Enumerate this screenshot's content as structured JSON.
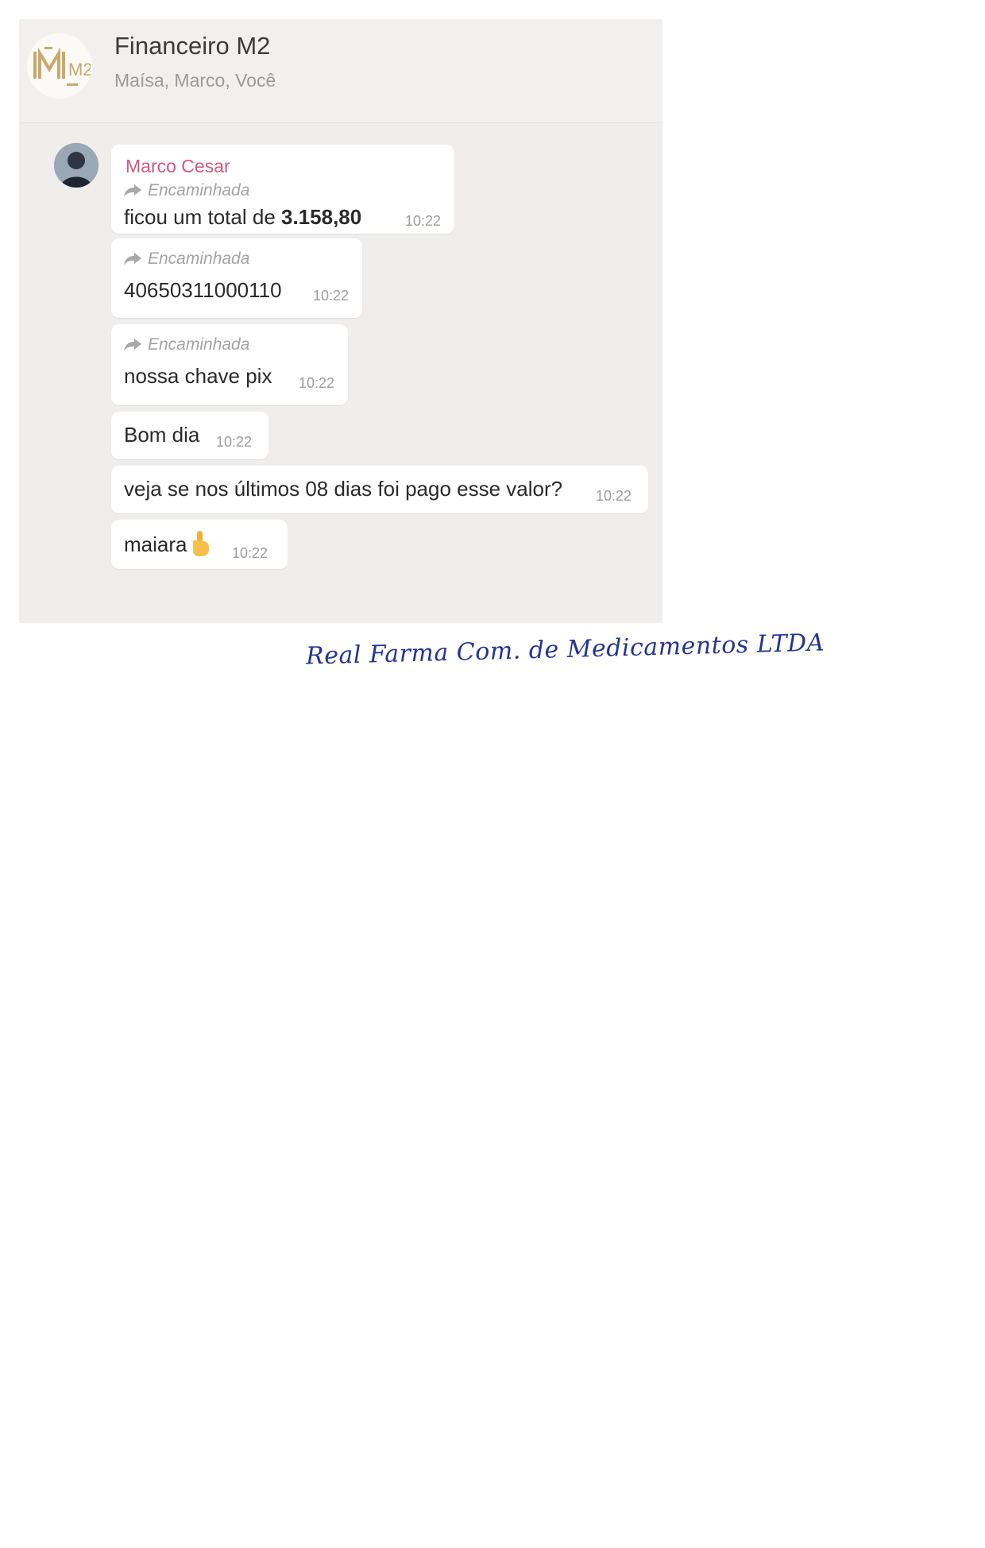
{
  "header": {
    "title": "Financeiro M2",
    "members": "Maísa, Marco, Você",
    "logo_text": "M2"
  },
  "messages": [
    {
      "sender": "Marco Cesar",
      "forwarded": "Encaminhada",
      "text_prefix": "ficou um total de ",
      "text_bold": "3.158,80",
      "time": "10:22"
    },
    {
      "forwarded": "Encaminhada",
      "text": "40650311000110",
      "time": "10:22"
    },
    {
      "forwarded": "Encaminhada",
      "text": "nossa chave pix",
      "time": "10:22"
    },
    {
      "text": "Bom dia",
      "time": "10:22"
    },
    {
      "text": "veja se nos últimos 08 dias foi pago esse valor?",
      "time": "10:22"
    },
    {
      "text": "maiara",
      "emoji": "pointing-hand",
      "time": "10:22"
    }
  ],
  "annotation": {
    "handwritten_note": "Real Farma Com. de Medicamentos LTDA"
  },
  "colors": {
    "sender_name": "#d2577d",
    "chat_background": "#efeeec",
    "handwriting_ink": "#26348f"
  }
}
